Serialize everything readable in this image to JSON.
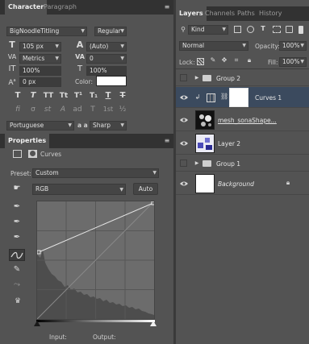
{
  "character_panel": {
    "tabs": [
      "Character",
      "Paragraph"
    ],
    "font_family": "BigNoodleTitling",
    "font_style": "Regular",
    "font_size": "105 px",
    "leading": "(Auto)",
    "kerning": "Metrics",
    "tracking": "0",
    "vertical_scale": "100%",
    "horizontal_scale": "100%",
    "baseline_shift": "0 px",
    "color_label": "Color:",
    "color_value": "#ffffff",
    "type_style_buttons": [
      "T",
      "T",
      "TT",
      "Tt",
      "T¹",
      "T₁",
      "T",
      "T"
    ],
    "opentype_buttons": [
      "fi",
      "σ",
      "st",
      "A",
      "ad",
      "T",
      "1st",
      "½"
    ],
    "language": "Portuguese",
    "aa_label": "a a",
    "antialias": "Sharp"
  },
  "properties_panel": {
    "title": "Properties",
    "adjustment": "Curves",
    "preset_label": "Preset:",
    "preset_value": "Custom",
    "channel": "RGB",
    "auto_label": "Auto",
    "input_label": "Input:",
    "output_label": "Output:"
  },
  "layers_panel": {
    "tabs": [
      "Layers",
      "Channels",
      "Paths",
      "History"
    ],
    "filter_kind": "Kind",
    "blend_mode": "Normal",
    "opacity_label": "Opacity:",
    "opacity_value": "100%",
    "lock_label": "Lock:",
    "fill_label": "Fill:",
    "fill_value": "100%",
    "layers": [
      {
        "name": "Group 2",
        "type": "group",
        "visible": false
      },
      {
        "name": "Curves 1",
        "type": "adjustment",
        "visible": true,
        "selected": true
      },
      {
        "name": "mesh_sonaShape...",
        "type": "smart",
        "visible": true
      },
      {
        "name": "Layer 2",
        "type": "pixel",
        "visible": true
      },
      {
        "name": "Group 1",
        "type": "group",
        "visible": false
      },
      {
        "name": "Background",
        "type": "background",
        "visible": true
      }
    ]
  },
  "colors": {
    "panel": "#535353",
    "tabbar": "#323232",
    "selected_row": "#3b4a5e",
    "curve": "#e6e6e6"
  }
}
